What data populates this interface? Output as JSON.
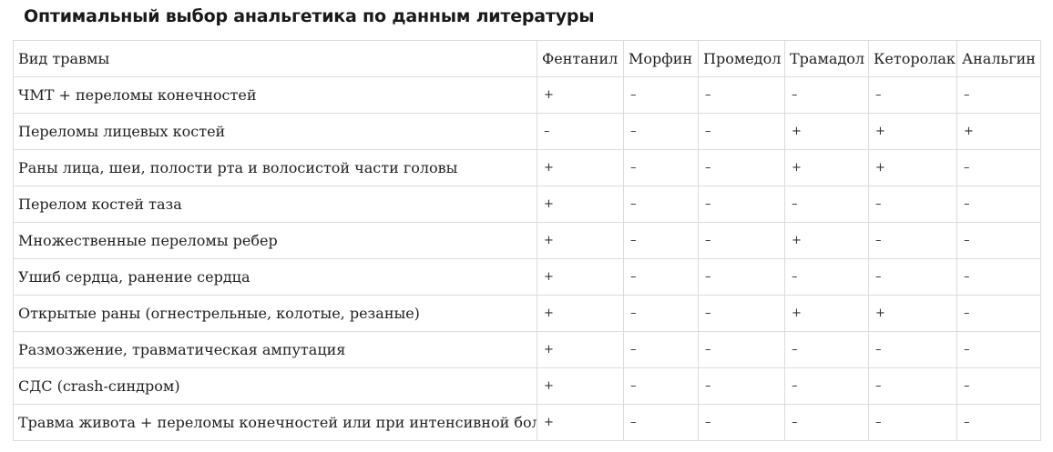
{
  "title": "Оптимальный выбор анальгетика по данным литературы",
  "table": {
    "header": [
      "Вид травмы",
      "Фентанил",
      "Морфин",
      "Промедол",
      "Трамадол",
      "Кеторолак",
      "Анальгин"
    ],
    "rows": [
      {
        "injury": "ЧМТ + переломы конечностей",
        "marks": [
          "+",
          "–",
          "–",
          "–",
          "–",
          "–"
        ]
      },
      {
        "injury": "Переломы лицевых костей",
        "marks": [
          "–",
          "–",
          "–",
          "+",
          "+",
          "+"
        ]
      },
      {
        "injury": "Раны лица, шеи, полости рта и волосистой части головы",
        "marks": [
          "+",
          "–",
          "–",
          "+",
          "+",
          "–"
        ]
      },
      {
        "injury": "Перелом костей таза",
        "marks": [
          "+",
          "–",
          "–",
          "–",
          "–",
          "–"
        ]
      },
      {
        "injury": "Множественные переломы ребер",
        "marks": [
          "+",
          "–",
          "–",
          "+",
          "–",
          "–"
        ]
      },
      {
        "injury": "Ушиб сердца, ранение сердца",
        "marks": [
          "+",
          "–",
          "–",
          "–",
          "–",
          "–"
        ]
      },
      {
        "injury": "Открытые раны (огнестрельные, колотые, резаные)",
        "marks": [
          "+",
          "–",
          "–",
          "+",
          "+",
          "–"
        ]
      },
      {
        "injury": "Размозжение, травматическая ампутация",
        "marks": [
          "+",
          "–",
          "–",
          "–",
          "–",
          "–"
        ]
      },
      {
        "injury": "СДС (crash-синдром)",
        "marks": [
          "+",
          "–",
          "–",
          "–",
          "–",
          "–"
        ]
      },
      {
        "injury": "Травма живота + переломы конечностей или при интенсивной боли",
        "marks": [
          "+",
          "–",
          "–",
          "–",
          "–",
          "–"
        ]
      }
    ]
  }
}
